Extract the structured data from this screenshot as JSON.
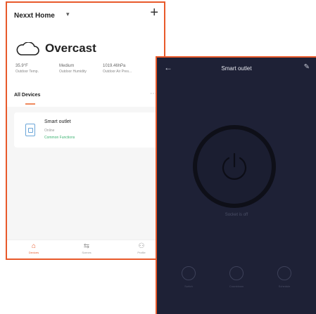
{
  "home": {
    "title": "Nexxt Home",
    "weather": {
      "condition": "Overcast",
      "stats": [
        {
          "value": "35.9°F",
          "label": "Outdoor Temp."
        },
        {
          "value": "Medium",
          "label": "Outdoor Humidity"
        },
        {
          "value": "1019.46hPa",
          "label": "Outdoor Air Pres..."
        }
      ]
    },
    "devices_heading": "All Devices",
    "device": {
      "name": "Smart outlet",
      "status": "Online",
      "functions": "Common Functions"
    },
    "tabs": [
      {
        "label": "Devices",
        "icon": "home-icon"
      },
      {
        "label": "Scenes",
        "icon": "scene-icon"
      },
      {
        "label": "Profile",
        "icon": "profile-icon"
      }
    ]
  },
  "detail": {
    "title": "Smart outlet",
    "status_text": "Socket is off",
    "controls": [
      {
        "label": "Switch",
        "icon": "switch-icon"
      },
      {
        "label": "Countdown",
        "icon": "countdown-icon"
      },
      {
        "label": "Schedule",
        "icon": "schedule-icon"
      }
    ]
  },
  "colors": {
    "accent": "#e8592a",
    "success": "#3cb371",
    "dark_bg": "#1e2136"
  }
}
